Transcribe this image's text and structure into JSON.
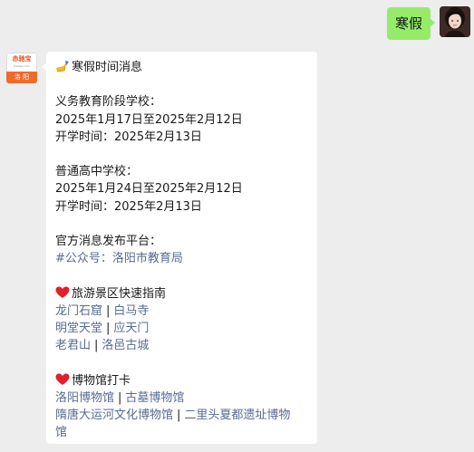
{
  "outgoing": {
    "text": "寒假"
  },
  "bot": {
    "logo_top": "赤驰宝",
    "logo_mid": "hunbao.com",
    "logo_bottom": "洛 阳"
  },
  "message": {
    "title": "寒假时间消息",
    "compulsory": {
      "heading": "义务教育阶段学校：",
      "range": "2025年1月17日至2025年2月12日",
      "start": "开学时间：2025年2月13日"
    },
    "high_school": {
      "heading": "普通高中学校：",
      "range": "2025年1月24日至2025年2月12日",
      "start": "开学时间：2025年2月13日"
    },
    "official": {
      "heading": "官方消息发布平台：",
      "link": "#公众号：洛阳市教育局"
    },
    "scenic": {
      "heading": "旅游景区快速指南",
      "rows": [
        [
          "龙门石窟",
          "白马寺"
        ],
        [
          "明堂天堂",
          "应天门"
        ],
        [
          "老君山",
          "洛邑古城"
        ]
      ]
    },
    "museum": {
      "heading": "博物馆打卡",
      "row1": [
        "洛阳博物馆",
        "古墓博物馆"
      ],
      "row2": [
        "隋唐大运河文化博物馆",
        "二里头夏都遗址博物"
      ],
      "row2_wrap": "馆"
    },
    "separator": "|"
  },
  "colors": {
    "background": "#ededed",
    "outgoing_bubble": "#95ec69",
    "link": "#576b95",
    "heart": "#e0202a",
    "bot_logo_orange": "#f06a2b"
  },
  "icons": {
    "title": "writing-hand-icon",
    "scenic": "red-heart-icon",
    "museum": "red-heart-icon"
  }
}
